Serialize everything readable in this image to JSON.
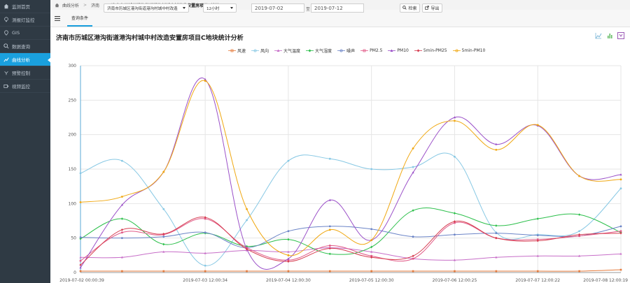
{
  "sidebar": {
    "items": [
      {
        "label": "监测首页",
        "icon": "home-icon"
      },
      {
        "label": "测报灯监控",
        "icon": "lamp-icon"
      },
      {
        "label": "GIS",
        "icon": "map-icon"
      },
      {
        "label": "数据查询",
        "icon": "search-icon"
      },
      {
        "label": "曲线分析",
        "icon": "chart-icon",
        "active": true
      },
      {
        "label": "预警控制",
        "icon": "alarm-icon"
      },
      {
        "label": "视频监控",
        "icon": "video-icon"
      }
    ]
  },
  "breadcrumb": {
    "items": [
      "曲线分析",
      "济南",
      "济南市历城区港沟街道港沟村城中村改造安置房项目C地块"
    ]
  },
  "filter": {
    "query_label": "查询条件",
    "site_select": "济南市历城区港沟街道港沟村城中村改造",
    "interval_select": "12小时",
    "start_date": "2019-07-02",
    "to_label": "至",
    "end_date": "2019-07-12",
    "search_button": "检索",
    "export_button": "导出"
  },
  "title": "济南市历城区港沟街道港沟村城中村改造安置房项目C地块统计分析",
  "colors": {
    "accent": "#1aa0de",
    "sidebar_bg": "#2f3a44"
  },
  "chart_data": {
    "type": "line",
    "x": [
      "2019-07-02 00:00:39",
      "2019-07-02 12:00:00",
      "2019-07-03 00:00:00",
      "2019-07-03 12:00:34",
      "2019-07-04 00:00:00",
      "2019-07-04 12:00:30",
      "2019-07-05 00:00:00",
      "2019-07-05 12:00:30",
      "2019-07-06 00:00:00",
      "2019-07-06 12:00:25",
      "2019-07-07 00:00:00",
      "2019-07-07 12:00:22",
      "2019-07-08 00:00:00",
      "2019-07-08 12:00:19"
    ],
    "x_tick_labels": [
      "2019-07-02 00:00:39",
      "2019-07-03 12:00:34",
      "2019-07-04 12:00:30",
      "2019-07-05 12:00:30",
      "2019-07-06 12:00:25",
      "2019-07-07 12:00:22",
      "2019-07-08 12:00:19"
    ],
    "ylim": [
      0,
      300
    ],
    "y_ticks": [
      0,
      50,
      100,
      150,
      200,
      250,
      300
    ],
    "grid": true,
    "legend_position": "top",
    "series": [
      {
        "name": "风速",
        "color": "#e57a3b",
        "marker": "square",
        "values": [
          2,
          2,
          2,
          2,
          2,
          2,
          2,
          2,
          2,
          2,
          2,
          2,
          2,
          4
        ]
      },
      {
        "name": "风向",
        "color": "#87c8e4",
        "marker": "circle",
        "values": [
          144,
          162,
          92,
          10,
          76,
          162,
          165,
          150,
          153,
          168,
          58,
          55,
          60,
          122
        ]
      },
      {
        "name": "大气温度",
        "color": "#c76ec8",
        "marker": "triangle",
        "values": [
          22,
          22,
          30,
          28,
          32,
          30,
          36,
          30,
          20,
          18,
          22,
          24,
          24,
          27
        ]
      },
      {
        "name": "大气湿度",
        "color": "#2bbf4a",
        "marker": "diamond",
        "values": [
          49,
          78,
          41,
          57,
          38,
          48,
          27,
          37,
          90,
          86,
          68,
          78,
          84,
          58
        ]
      },
      {
        "name": "噪声",
        "color": "#6b84c7",
        "marker": "circle",
        "values": [
          51,
          50,
          52,
          58,
          36,
          60,
          67,
          63,
          52,
          55,
          57,
          54,
          53,
          67
        ]
      },
      {
        "name": "PM2.5",
        "color": "#e15a87",
        "marker": "square",
        "values": [
          17,
          58,
          55,
          78,
          36,
          18,
          39,
          24,
          20,
          72,
          50,
          48,
          53,
          60
        ]
      },
      {
        "name": "PM10",
        "color": "#9a4fc8",
        "marker": "triangle",
        "values": [
          7,
          98,
          146,
          280,
          34,
          20,
          105,
          47,
          145,
          225,
          186,
          213,
          140,
          142
        ]
      },
      {
        "name": "5min-PM25",
        "color": "#d63d50",
        "marker": "diamond",
        "values": [
          11,
          62,
          56,
          80,
          34,
          16,
          35,
          22,
          24,
          74,
          50,
          46,
          55,
          57
        ]
      },
      {
        "name": "5min-PM10",
        "color": "#f0a812",
        "marker": "circle",
        "values": [
          102,
          110,
          146,
          278,
          92,
          25,
          62,
          47,
          180,
          220,
          178,
          214,
          140,
          135
        ]
      }
    ]
  }
}
